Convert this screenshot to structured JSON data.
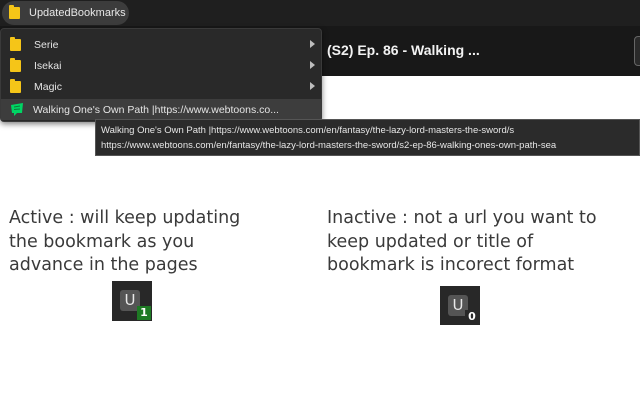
{
  "bookmark_bar": {
    "folder_label": "UpdatedBookmarks"
  },
  "page_header": {
    "title": "(S2) Ep. 86 - Walking ..."
  },
  "dropdown": {
    "items": [
      {
        "label": "Serie",
        "icon": "folder-icon",
        "has_submenu": true
      },
      {
        "label": "Isekai",
        "icon": "folder-icon",
        "has_submenu": true
      },
      {
        "label": "Magic",
        "icon": "folder-icon",
        "has_submenu": true
      },
      {
        "label": "Walking One's Own Path |https://www.webtoons.co...",
        "icon": "webtoon-icon",
        "has_submenu": false
      }
    ]
  },
  "tooltip": {
    "line1": "Walking One's Own Path |https://www.webtoons.com/en/fantasy/the-lazy-lord-masters-the-sword/s",
    "line2": "https://www.webtoons.com/en/fantasy/the-lazy-lord-masters-the-sword/s2-ep-86-walking-ones-own-path-sea"
  },
  "active": {
    "lines": [
      "Active : will keep updating",
      "the bookmark as you",
      "advance in the pages"
    ],
    "icon_letter": "U",
    "badge": "1"
  },
  "inactive": {
    "lines": [
      "Inactive : not a url you want to",
      "keep updated or title of",
      "bookmark is incorect format"
    ],
    "icon_letter": "U",
    "badge": "0"
  },
  "colors": {
    "folder": "#f5c518",
    "webtoon_green": "#00d564",
    "active_badge": "#1e7a24"
  }
}
